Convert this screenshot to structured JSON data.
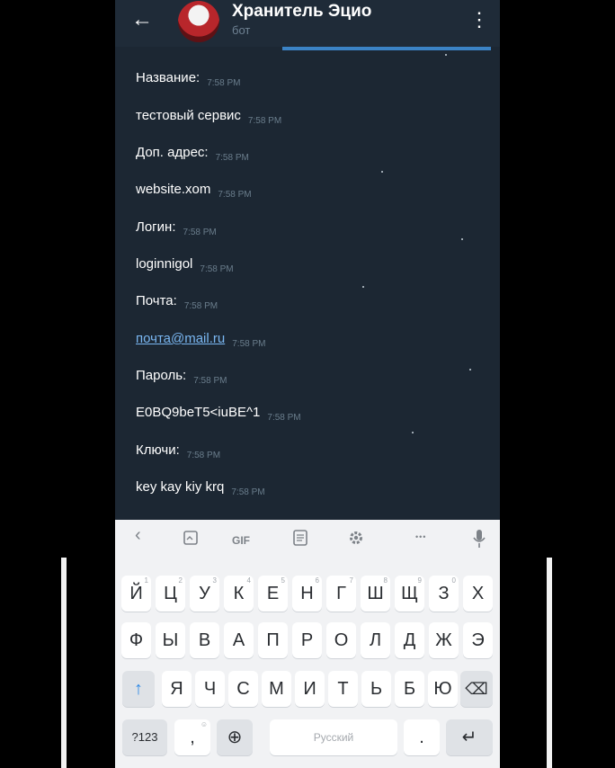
{
  "header": {
    "back_icon": "arrow-left-icon",
    "title": "Хранитель Эцио",
    "subtitle": "бот",
    "menu_icon": "kebab-menu-icon"
  },
  "messages": [
    {
      "text": "Название:",
      "time": "7:58 PM"
    },
    {
      "text": "тестовый сервис",
      "time": "7:58 PM"
    },
    {
      "text": "Доп. адрес:",
      "time": "7:58 PM"
    },
    {
      "text": "website.xom",
      "time": "7:58 PM"
    },
    {
      "text": "Логин:",
      "time": "7:58 PM"
    },
    {
      "text": "loginnigol",
      "time": "7:58 PM"
    },
    {
      "text": "Почта:",
      "time": "7:58 PM"
    },
    {
      "text": "почта@mail.ru",
      "time": "7:58 PM"
    },
    {
      "text": "Пароль:",
      "time": "7:58 PM"
    },
    {
      "text": "E0BQ9beT5<iuBE^1",
      "time": "7:58 PM"
    },
    {
      "text": "Ключи:",
      "time": "7:58 PM"
    },
    {
      "text": "key kay kiy krq",
      "time": "7:58 PM"
    }
  ],
  "keyboard": {
    "toolbar": {
      "back_glyph": "‹",
      "clipboard_icon": "clipboard-icon",
      "gif_label": "GIF",
      "notes_icon": "notes-icon",
      "settings_icon": "gear-icon",
      "more_glyph": "•••",
      "mic_icon": "microphone-icon"
    },
    "row1": [
      {
        "ch": "Й",
        "n": "1"
      },
      {
        "ch": "Ц",
        "n": "2"
      },
      {
        "ch": "У",
        "n": "3"
      },
      {
        "ch": "К",
        "n": "4"
      },
      {
        "ch": "Е",
        "n": "5"
      },
      {
        "ch": "Н",
        "n": "6"
      },
      {
        "ch": "Г",
        "n": "7"
      },
      {
        "ch": "Ш",
        "n": "8"
      },
      {
        "ch": "Щ",
        "n": "9"
      },
      {
        "ch": "З",
        "n": "0"
      },
      {
        "ch": "Х",
        "n": ""
      }
    ],
    "row2": [
      "Ф",
      "Ы",
      "В",
      "А",
      "П",
      "Р",
      "О",
      "Л",
      "Д",
      "Ж",
      "Э"
    ],
    "row3": [
      "Я",
      "Ч",
      "С",
      "М",
      "И",
      "Т",
      "Ь",
      "Б",
      "Ю"
    ],
    "shift_glyph": "↑",
    "delete_glyph": "⌫",
    "numbers_label": "?123",
    "punct_label": ",",
    "punct_secondary": "☺",
    "globe_glyph": "⊕",
    "space_label": "Русский",
    "period_label": ".",
    "enter_glyph": "↵"
  }
}
